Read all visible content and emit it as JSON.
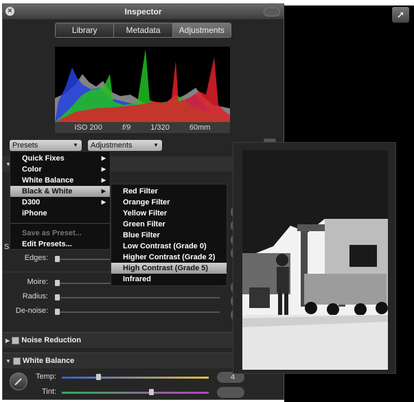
{
  "window": {
    "title": "Inspector"
  },
  "tabs": [
    "Library",
    "Metadata",
    "Adjustments"
  ],
  "active_tab": "Adjustments",
  "exif": {
    "iso": "ISO 200",
    "aperture": "f/9",
    "shutter": "1/320",
    "focal": "60mm"
  },
  "presets_label": "Presets",
  "adjustments_label": "Adjustments",
  "presets_menu": {
    "items": [
      "Quick Fixes",
      "Color",
      "White Balance",
      "Black & White",
      "D300",
      "iPhone"
    ],
    "selected": "Black & White",
    "save_preset": "Save as Preset...",
    "edit_presets": "Edit Presets..."
  },
  "bw_submenu": {
    "items": [
      "Red Filter",
      "Orange Filter",
      "Yellow Filter",
      "Green Filter",
      "Blue Filter",
      "Low Contrast (Grade 0)",
      "Higher Contrast (Grade 2)",
      "High Contrast (Grade 5)",
      "Infrared"
    ],
    "selected": "High Contrast (Grade 5)"
  },
  "sliders": {
    "edges": "Edges:",
    "moire": "Moire:",
    "radius": "Radius:",
    "denoise": "De-noise:"
  },
  "partial_s": "S",
  "sections": {
    "noise_reduction": "Noise Reduction",
    "white_balance": "White Balance"
  },
  "white_balance": {
    "temp": "Temp:",
    "tint": "Tint:",
    "temp_value_partial": "4"
  },
  "colors": {
    "panel_bg": "#262626",
    "menu_bg": "#0f0f0f",
    "highlight": "#b5b5b5",
    "hist_red": "#e0202a",
    "hist_green": "#21c021",
    "hist_blue": "#2341e0"
  }
}
